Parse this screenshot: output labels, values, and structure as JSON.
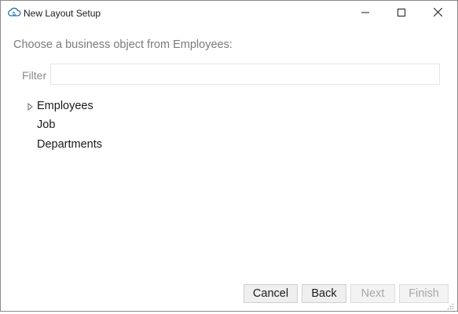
{
  "window": {
    "title": "New Layout Setup",
    "icon": "cloud-sync-icon"
  },
  "prompt": "Choose a business object from Employees:",
  "filter": {
    "label": "Filter",
    "value": "",
    "placeholder": ""
  },
  "tree": {
    "items": [
      {
        "label": "Employees",
        "expandable": true
      },
      {
        "label": "Job",
        "expandable": false
      },
      {
        "label": "Departments",
        "expandable": false
      }
    ]
  },
  "buttons": {
    "cancel": "Cancel",
    "back": "Back",
    "next": "Next",
    "finish": "Finish"
  },
  "colors": {
    "accent": "#2b6cb0",
    "disabled_text": "#a8a8a8"
  }
}
